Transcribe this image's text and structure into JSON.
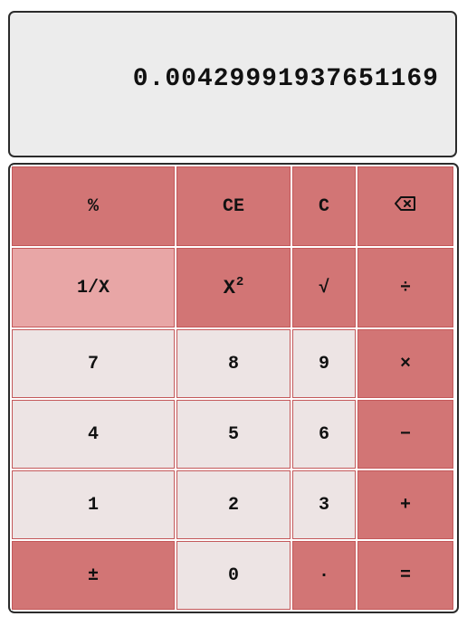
{
  "display": {
    "value": "0.00429991937651169"
  },
  "keys": {
    "percent": "%",
    "ce": "CE",
    "c": "C",
    "backspace_icon": "backspace",
    "reciprocal": "1/X",
    "square_base": "X",
    "square_exp": "2",
    "sqrt": "√",
    "divide": "÷",
    "seven": "7",
    "eight": "8",
    "nine": "9",
    "multiply": "×",
    "four": "4",
    "five": "5",
    "six": "6",
    "minus": "−",
    "one": "1",
    "two": "2",
    "three": "3",
    "plus": "+",
    "negate": "±",
    "zero": "0",
    "decimal": "·",
    "equals": "="
  },
  "colors": {
    "operator_key": "#d27575",
    "highlighted_key": "#e8a6a6",
    "number_key": "#ede4e4",
    "display_bg": "#ececec"
  }
}
